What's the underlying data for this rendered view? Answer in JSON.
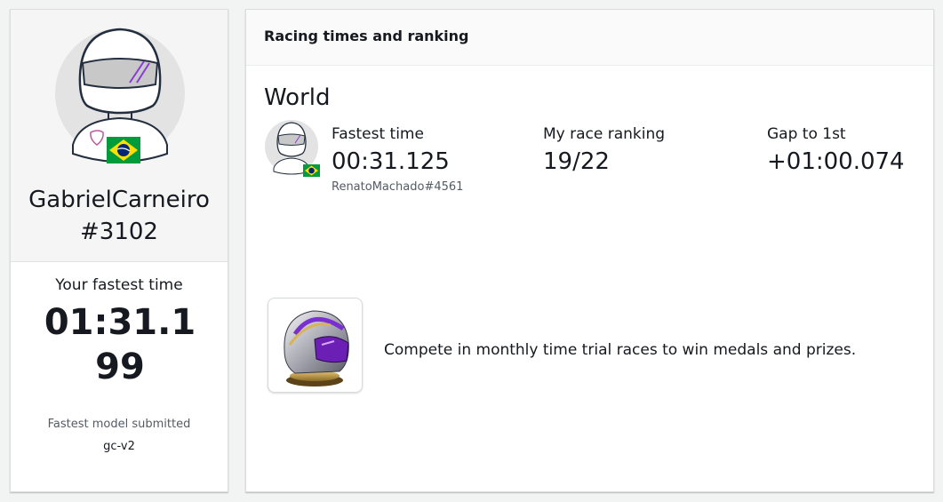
{
  "profile": {
    "username": "GabrielCarneiro",
    "tag": "#3102",
    "fastest_label": "Your fastest time",
    "fastest_value": "01:31.199",
    "model_label": "Fastest model submitted",
    "model_value": "gc-v2",
    "avatar_icon": "helmet-avatar-icon",
    "flag_icon": "brazil-flag-icon"
  },
  "racing": {
    "title": "Racing times and ranking",
    "section": "World",
    "stats": [
      {
        "label": "Fastest time",
        "value": "00:31.125",
        "sub": "RenatoMachado#4561"
      },
      {
        "label": "My race ranking",
        "value": "19/22"
      },
      {
        "label": "Gap to 1st",
        "value": "+01:00.074"
      }
    ],
    "promo_text": "Compete in monthly time trial races to win medals and prizes.",
    "medal_icon": "helmet-trophy-icon"
  },
  "colors": {
    "background": "#f2f3f3",
    "helmet_purple": "#8a3bd6",
    "flag_green": "#009b3a",
    "flag_yellow": "#fedf00",
    "flag_blue": "#002776"
  }
}
